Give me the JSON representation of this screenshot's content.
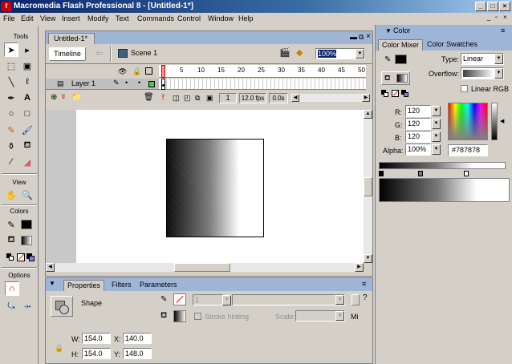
{
  "window": {
    "title": "Macromedia Flash Professional 8 - [Untitled-1*]",
    "logo": "f"
  },
  "menu": [
    "File",
    "Edit",
    "View",
    "Insert",
    "Modify",
    "Text",
    "Commands",
    "Control",
    "Window",
    "Help"
  ],
  "tools": {
    "title": "Tools",
    "view_label": "View",
    "colors_label": "Colors",
    "options_label": "Options"
  },
  "document": {
    "tab": "Untitled-1*",
    "timeline_button": "Timeline",
    "scene": "Scene 1",
    "zoom": "100%",
    "layer_name": "Layer 1",
    "frame": "1",
    "fps": "12.0 fps",
    "time": "0.0s",
    "frame_numbers": [
      "5",
      "10",
      "15",
      "20",
      "25",
      "30",
      "35",
      "40",
      "45",
      "50"
    ]
  },
  "properties": {
    "tabs": [
      "Properties",
      "Filters",
      "Parameters"
    ],
    "object_type": "Shape",
    "stroke_value": "1",
    "stroke_hinting": "Stroke hinting",
    "scale_label": "Scale:",
    "mi": "Mi",
    "w_label": "W:",
    "w": "154.0",
    "h_label": "H:",
    "h": "154.0",
    "x_label": "X:",
    "x": "140.0",
    "y_label": "Y:",
    "y": "148.0"
  },
  "color_panel": {
    "title": "Color",
    "tabs": [
      "Color Mixer",
      "Color Swatches"
    ],
    "type_label": "Type:",
    "type_value": "Linear",
    "overflow_label": "Overflow:",
    "linear_rgb": "Linear RGB",
    "r_label": "R:",
    "r": "120",
    "g_label": "G:",
    "g": "120",
    "b_label": "B:",
    "b": "120",
    "alpha_label": "Alpha:",
    "alpha": "100%",
    "hex": "#787878"
  },
  "colors": {
    "accent": "#0a246a",
    "stage": "#ffffff",
    "layer_highlight": "#c0c0c0",
    "playhead": "#ff0000"
  }
}
